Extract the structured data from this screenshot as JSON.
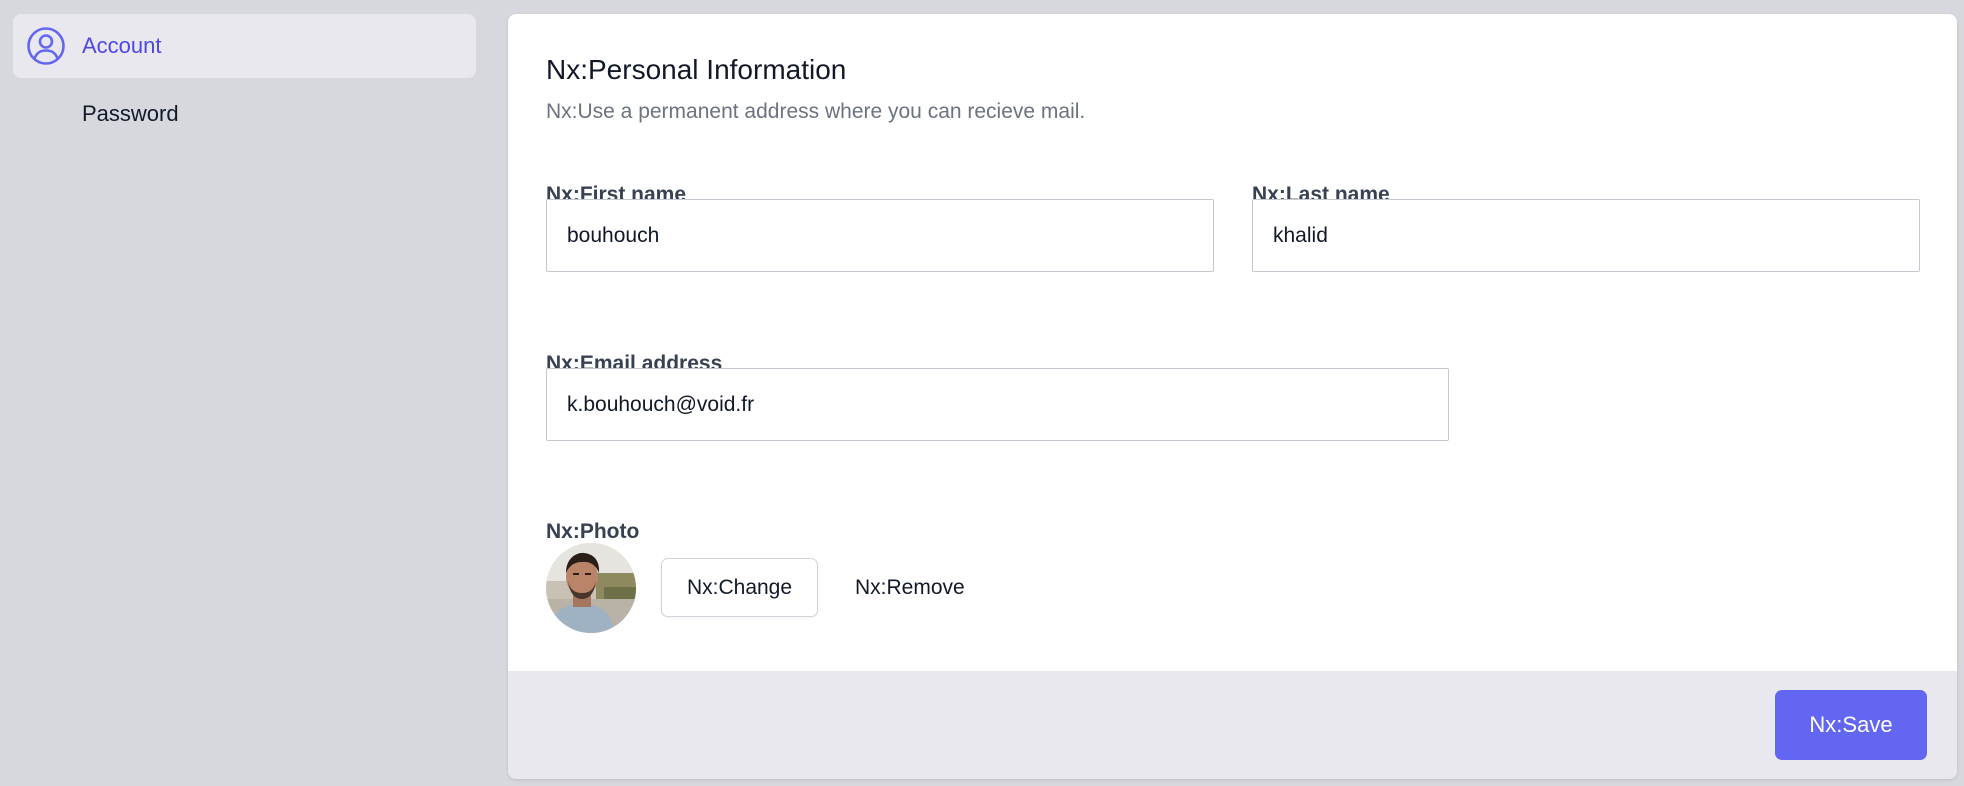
{
  "sidebar": {
    "items": [
      {
        "label": "Account",
        "icon": "user-circle-icon",
        "active": true
      },
      {
        "label": "Password",
        "active": false
      }
    ]
  },
  "form": {
    "title": "Nx:Personal Information",
    "subtitle": "Nx:Use a permanent address where you can recieve mail.",
    "first_name": {
      "label": "Nx:First name",
      "value": "bouhouch"
    },
    "last_name": {
      "label": "Nx:Last name",
      "value": "khalid"
    },
    "email": {
      "label": "Nx:Email address",
      "value": "k.bouhouch@void.fr"
    },
    "photo": {
      "label": "Nx:Photo",
      "change_label": "Nx:Change",
      "remove_label": "Nx:Remove"
    },
    "save_label": "Nx:Save"
  },
  "colors": {
    "accent": "#6366f1",
    "active_nav_text": "#4f46e5",
    "page_background": "#d7d8dd",
    "footer_background": "#e8e8ee"
  }
}
